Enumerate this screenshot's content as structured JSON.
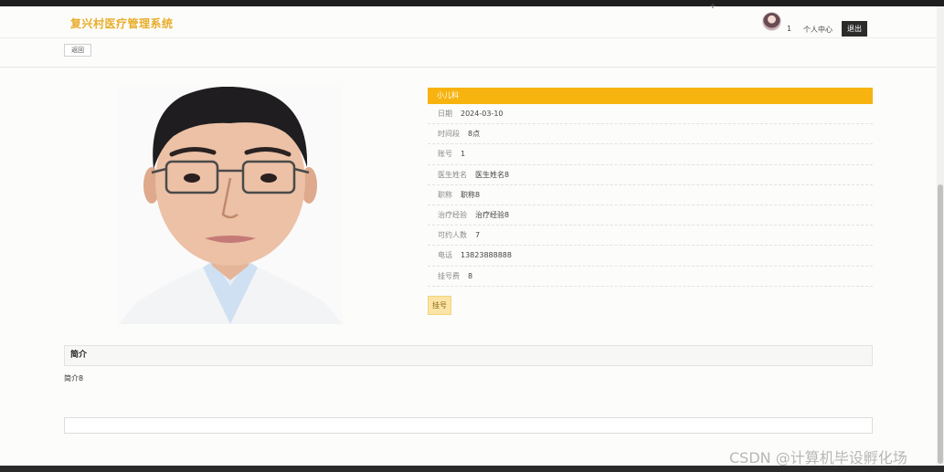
{
  "header": {
    "brand": "复兴村医疗管理系统",
    "user_id": "1",
    "personal_center": "个人中心",
    "logout": "退出"
  },
  "toolbar": {
    "back_label": "返回"
  },
  "doctor": {
    "department": "小儿科",
    "fields": [
      {
        "label": "日期",
        "value": "2024-03-10"
      },
      {
        "label": "时间段",
        "value": "8点"
      },
      {
        "label": "账号",
        "value": "1"
      },
      {
        "label": "医生姓名",
        "value": "医生姓名8"
      },
      {
        "label": "职称",
        "value": "职称8"
      },
      {
        "label": "治疗经验",
        "value": "治疗经验8"
      },
      {
        "label": "可约人数",
        "value": "7"
      },
      {
        "label": "电话",
        "value": "13823888888"
      },
      {
        "label": "挂号费",
        "value": "8"
      }
    ],
    "book_label": "挂号"
  },
  "intro": {
    "heading": "简介",
    "text": "简介8"
  },
  "watermark": "CSDN @计算机毕设孵化场",
  "colors": {
    "brand": "#e8ad2a",
    "accent": "#f7b30f",
    "logout_bg": "#2b2b2b"
  }
}
